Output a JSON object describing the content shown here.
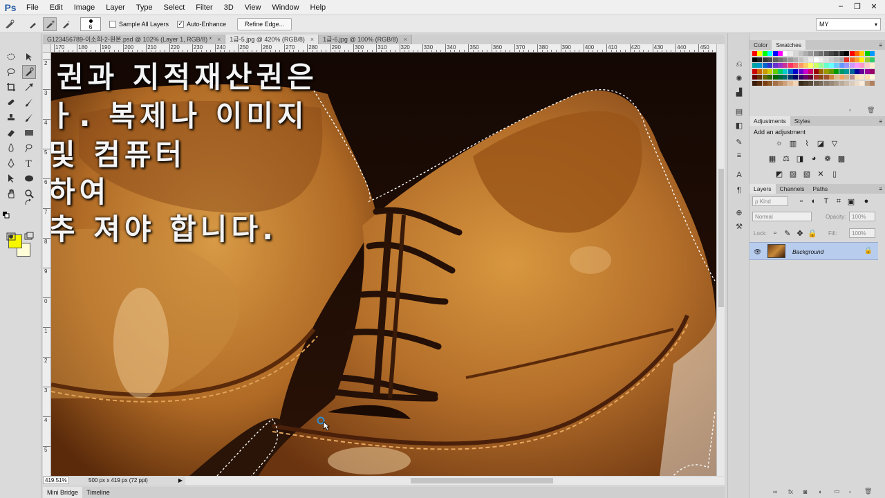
{
  "app": {
    "logo": "Ps"
  },
  "menu": [
    "File",
    "Edit",
    "Image",
    "Layer",
    "Type",
    "Select",
    "Filter",
    "3D",
    "View",
    "Window",
    "Help"
  ],
  "window_controls": {
    "minimize": "–",
    "maximize": "❐",
    "close": "✕"
  },
  "options": {
    "brush_size": "6",
    "sample_all_layers": "Sample All Layers",
    "auto_enhance": "Auto-Enhance",
    "auto_enhance_checked": "✓",
    "refine_edge": "Refine Edge...",
    "workspace": "MY"
  },
  "doc_tabs": [
    {
      "label": "G123456789-이소희-2-원본.psd @ 102% (Layer 1, RGB/8) *",
      "close": "×"
    },
    {
      "label": "1급-5.jpg @ 420% (RGB/8)",
      "close": "×"
    },
    {
      "label": "1급-6.jpg @ 100% (RGB/8)",
      "close": "×"
    }
  ],
  "ruler_h": [
    "170",
    "180",
    "190",
    "200",
    "210",
    "220",
    "230",
    "240",
    "250",
    "260",
    "270",
    "280",
    "290",
    "300",
    "310",
    "320",
    "330",
    "340",
    "350",
    "360",
    "370",
    "380",
    "390",
    "400",
    "410",
    "420",
    "430",
    "440",
    "450"
  ],
  "ruler_v": [
    "2",
    "3",
    "4",
    "5",
    "6",
    "7",
    "8",
    "9",
    "0",
    "1",
    "2",
    "3",
    "4",
    "5"
  ],
  "overlay_text": {
    "line1": "권과 지적재산권은",
    "line2": "ㅏ. 복제나 이미지",
    "line3": "및 컴퓨터",
    "line4": "하여",
    "line5": "추 져야 합니다."
  },
  "status": {
    "zoom": "419.51%",
    "doc_info": "500 px x 419 px (72 ppi)",
    "arrow": "▶"
  },
  "bottom_tabs": [
    "Mini Bridge",
    "Timeline"
  ],
  "panels": {
    "color_tabs": [
      "Color",
      "Swatches"
    ],
    "adjust_tabs": [
      "Adjustments",
      "Styles"
    ],
    "add_adjustment": "Add an adjustment",
    "layer_tabs": [
      "Layers",
      "Channels",
      "Paths"
    ],
    "kind": "ρ Kind",
    "blend_mode": "Normal",
    "opacity_label": "Opacity:",
    "opacity_value": "100%",
    "lock_label": "Lock:",
    "fill_label": "Fill:",
    "fill_value": "100%",
    "layer_name": "Background"
  },
  "colors": {
    "foreground": "#f7f700",
    "background": "#fffcd8",
    "layer_selected": "#b8cdee"
  }
}
